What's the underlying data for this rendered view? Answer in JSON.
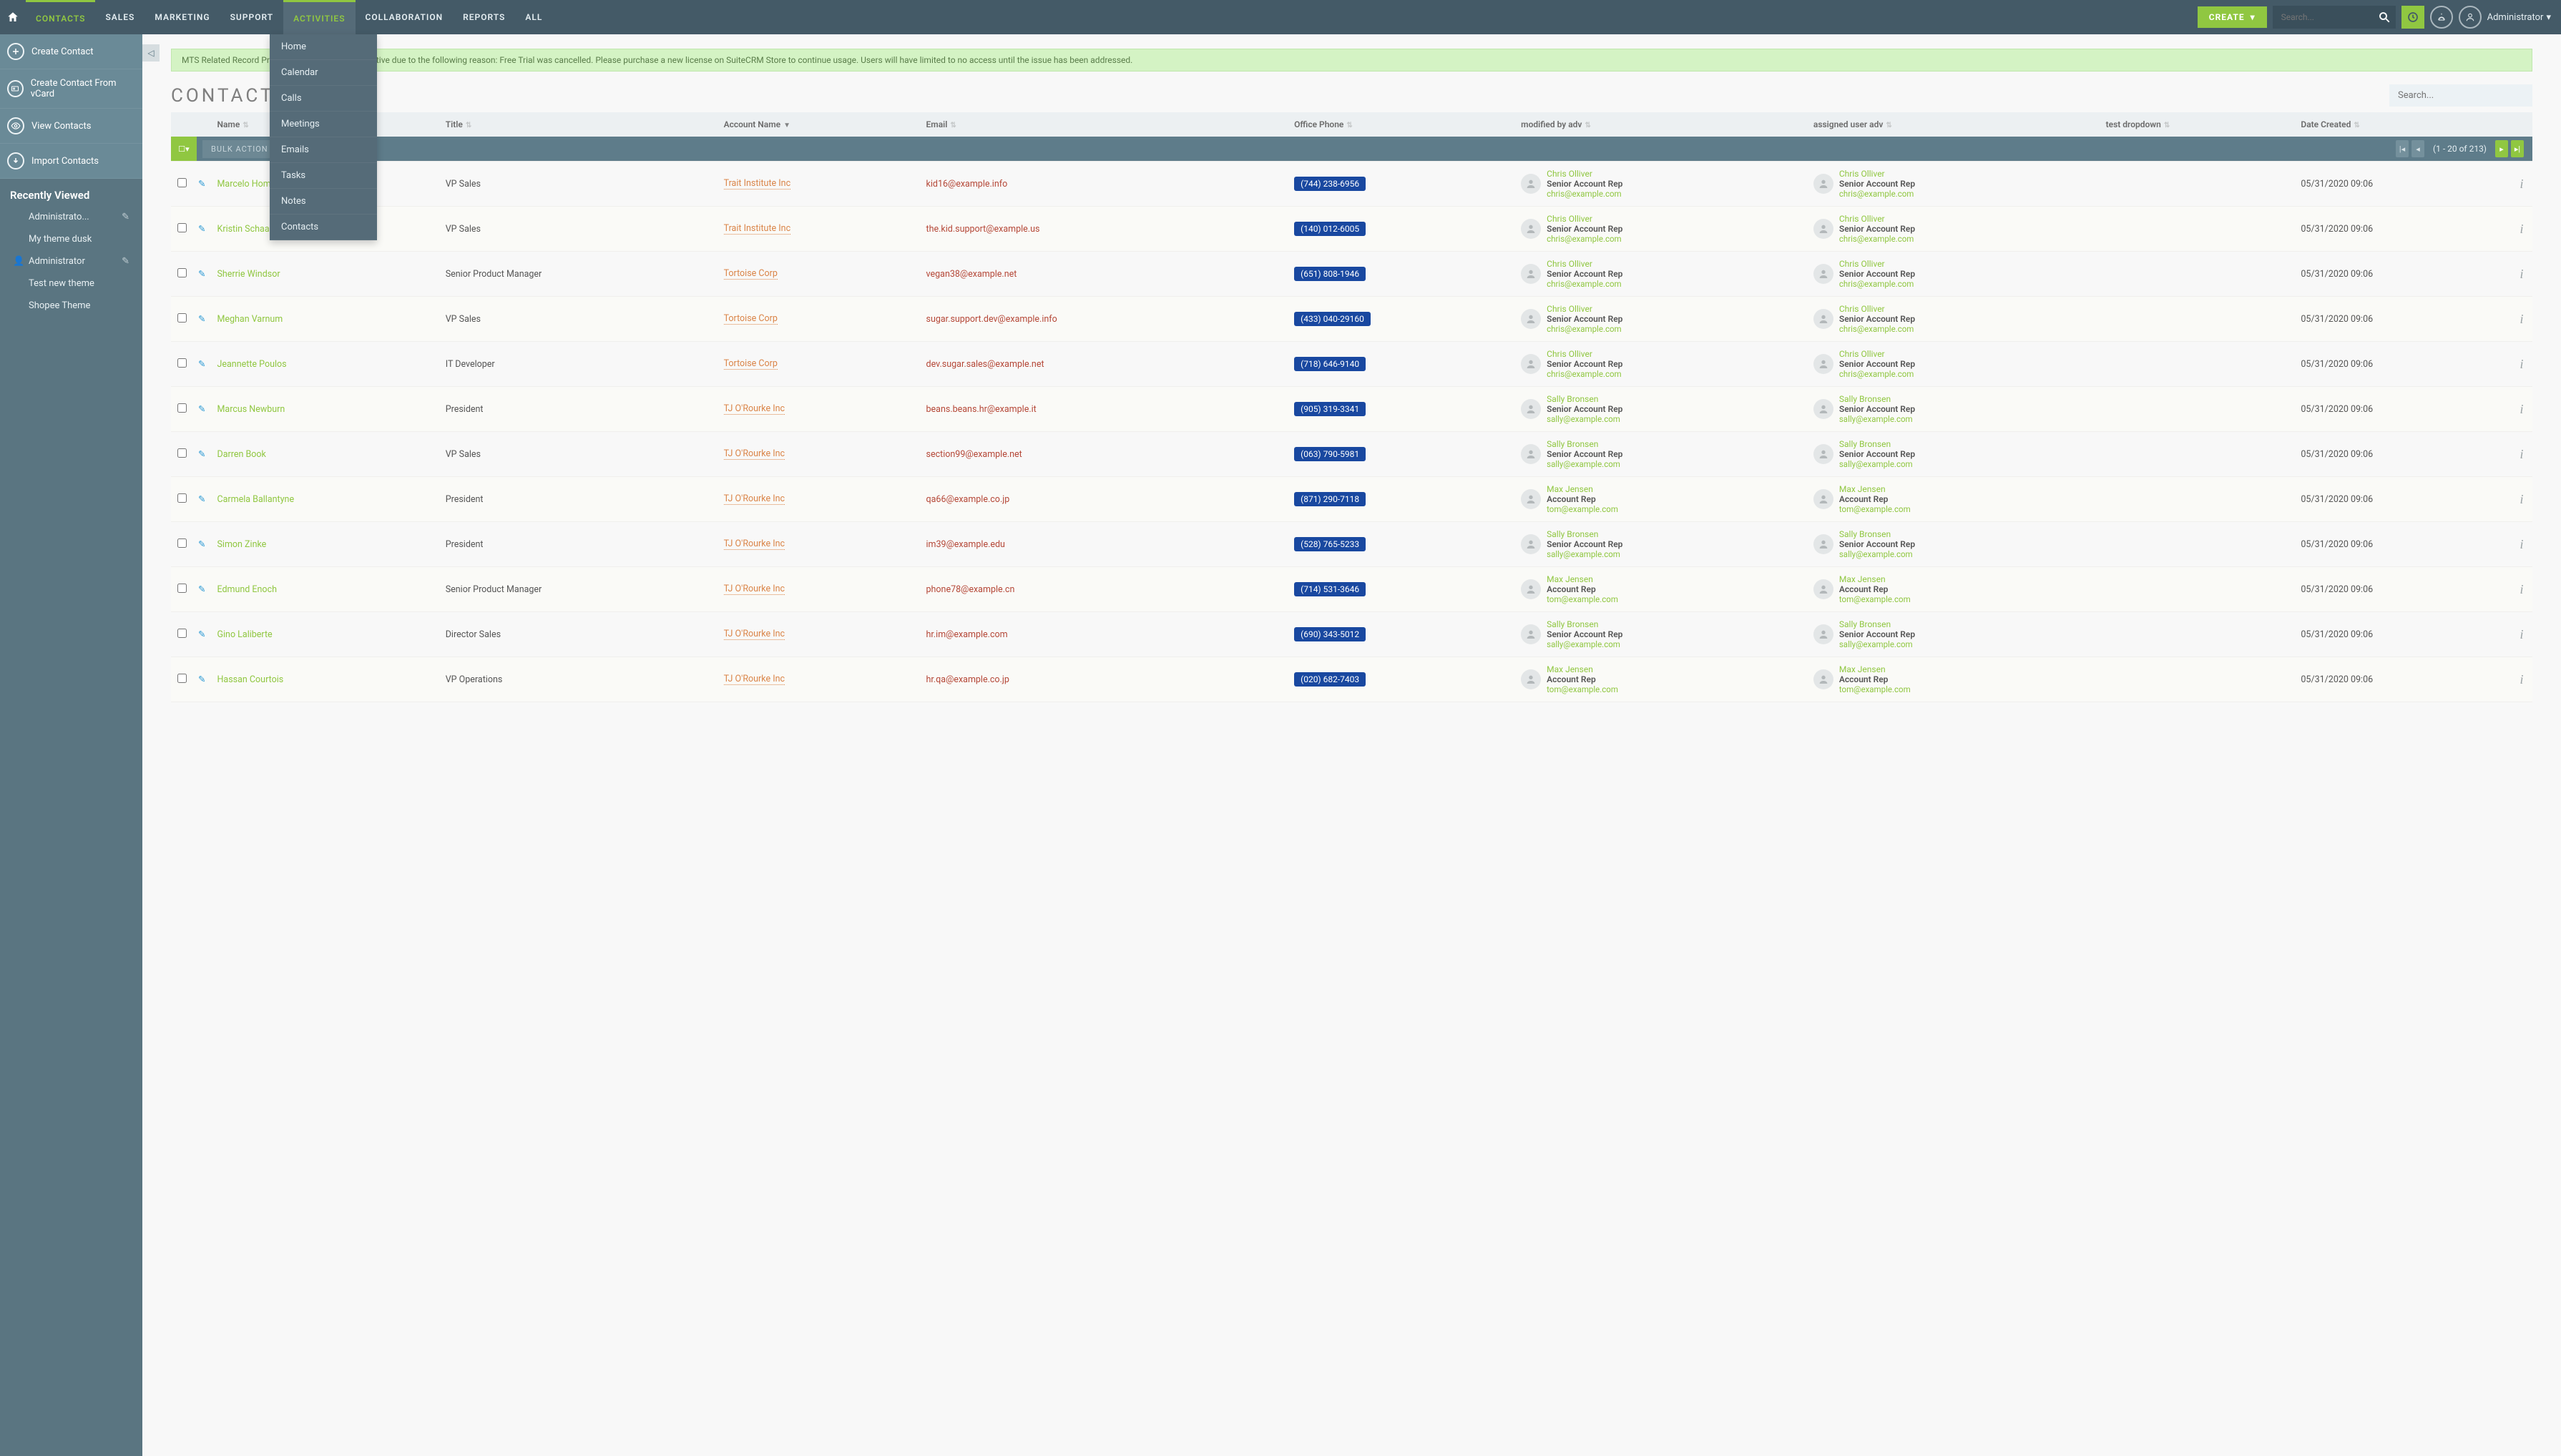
{
  "topnav": [
    "CONTACTS",
    "SALES",
    "MARKETING",
    "SUPPORT",
    "ACTIVITIES",
    "COLLABORATION",
    "REPORTS",
    "ALL"
  ],
  "create_label": "CREATE",
  "search_placeholder": "Search...",
  "user_label": "Administrator",
  "activities_menu": [
    "Home",
    "Calendar",
    "Calls",
    "Meetings",
    "Emails",
    "Tasks",
    "Notes",
    "Contacts"
  ],
  "side_actions": [
    {
      "label": "Create Contact",
      "icon": "plus"
    },
    {
      "label": "Create Contact From vCard",
      "icon": "card"
    },
    {
      "label": "View Contacts",
      "icon": "eye"
    },
    {
      "label": "Import Contacts",
      "icon": "down"
    }
  ],
  "recently_viewed_title": "Recently Viewed",
  "recently_viewed": [
    {
      "label": "Administrato...",
      "pencil": true
    },
    {
      "label": "My theme dusk",
      "pencil": false
    },
    {
      "label": "Administrator",
      "pencil": true,
      "person": true
    },
    {
      "label": "Test new theme",
      "pencil": false
    },
    {
      "label": "Shopee Theme",
      "pencil": false
    }
  ],
  "banner": "MTS Related Record Preview Addon is no longer active due to the following reason: Free Trial was cancelled. Please purchase a new license on SuiteCRM Store to continue usage. Users will have limited to no access until the issue has been addressed.",
  "page_title": "CONTACTS",
  "page_search_placeholder": "Search...",
  "columns": [
    "Name",
    "Title",
    "Account Name",
    "Email",
    "Office Phone",
    "modified by adv",
    "assigned user adv",
    "test dropdown",
    "Date Created"
  ],
  "bulk_label": "BULK ACTION",
  "page_count": "(1 - 20 of 213)",
  "users": {
    "chris": {
      "name": "Chris Olliver",
      "role": "Senior Account Rep",
      "email": "chris@example.com"
    },
    "sally": {
      "name": "Sally Bronsen",
      "role": "Senior Account Rep",
      "email": "sally@example.com"
    },
    "max": {
      "name": "Max Jensen",
      "role": "Account Rep",
      "email": "tom@example.com"
    }
  },
  "rows": [
    {
      "name": "Marcelo Hom",
      "title": "VP Sales",
      "account": "Trait Institute Inc",
      "email": "kid16@example.info",
      "phone": "(744) 238-6956",
      "mod": "chris",
      "asg": "chris",
      "date": "05/31/2020 09:06"
    },
    {
      "name": "Kristin Schaal",
      "title": "VP Sales",
      "account": "Trait Institute Inc",
      "email": "the.kid.support@example.us",
      "phone": "(140) 012-6005",
      "mod": "chris",
      "asg": "chris",
      "date": "05/31/2020 09:06"
    },
    {
      "name": "Sherrie Windsor",
      "title": "Senior Product Manager",
      "account": "Tortoise Corp",
      "email": "vegan38@example.net",
      "phone": "(651) 808-1946",
      "mod": "chris",
      "asg": "chris",
      "date": "05/31/2020 09:06"
    },
    {
      "name": "Meghan Varnum",
      "title": "VP Sales",
      "account": "Tortoise Corp",
      "email": "sugar.support.dev@example.info",
      "phone": "(433) 040-29160",
      "mod": "chris",
      "asg": "chris",
      "date": "05/31/2020 09:06"
    },
    {
      "name": "Jeannette Poulos",
      "title": "IT Developer",
      "account": "Tortoise Corp",
      "email": "dev.sugar.sales@example.net",
      "phone": "(718) 646-9140",
      "mod": "chris",
      "asg": "chris",
      "date": "05/31/2020 09:06"
    },
    {
      "name": "Marcus Newburn",
      "title": "President",
      "account": "TJ O'Rourke Inc",
      "email": "beans.beans.hr@example.it",
      "phone": "(905) 319-3341",
      "mod": "sally",
      "asg": "sally",
      "date": "05/31/2020 09:06"
    },
    {
      "name": "Darren Book",
      "title": "VP Sales",
      "account": "TJ O'Rourke Inc",
      "email": "section99@example.net",
      "phone": "(063) 790-5981",
      "mod": "sally",
      "asg": "sally",
      "date": "05/31/2020 09:06"
    },
    {
      "name": "Carmela Ballantyne",
      "title": "President",
      "account": "TJ O'Rourke Inc",
      "email": "qa66@example.co.jp",
      "phone": "(871) 290-7118",
      "mod": "max",
      "asg": "max",
      "date": "05/31/2020 09:06"
    },
    {
      "name": "Simon Zinke",
      "title": "President",
      "account": "TJ O'Rourke Inc",
      "email": "im39@example.edu",
      "phone": "(528) 765-5233",
      "mod": "sally",
      "asg": "sally",
      "date": "05/31/2020 09:06"
    },
    {
      "name": "Edmund Enoch",
      "title": "Senior Product Manager",
      "account": "TJ O'Rourke Inc",
      "email": "phone78@example.cn",
      "phone": "(714) 531-3646",
      "mod": "max",
      "asg": "max",
      "date": "05/31/2020 09:06"
    },
    {
      "name": "Gino Laliberte",
      "title": "Director Sales",
      "account": "TJ O'Rourke Inc",
      "email": "hr.im@example.com",
      "phone": "(690) 343-5012",
      "mod": "sally",
      "asg": "sally",
      "date": "05/31/2020 09:06"
    },
    {
      "name": "Hassan Courtois",
      "title": "VP Operations",
      "account": "TJ O'Rourke Inc",
      "email": "hr.qa@example.co.jp",
      "phone": "(020) 682-7403",
      "mod": "max",
      "asg": "max",
      "date": "05/31/2020 09:06"
    }
  ]
}
